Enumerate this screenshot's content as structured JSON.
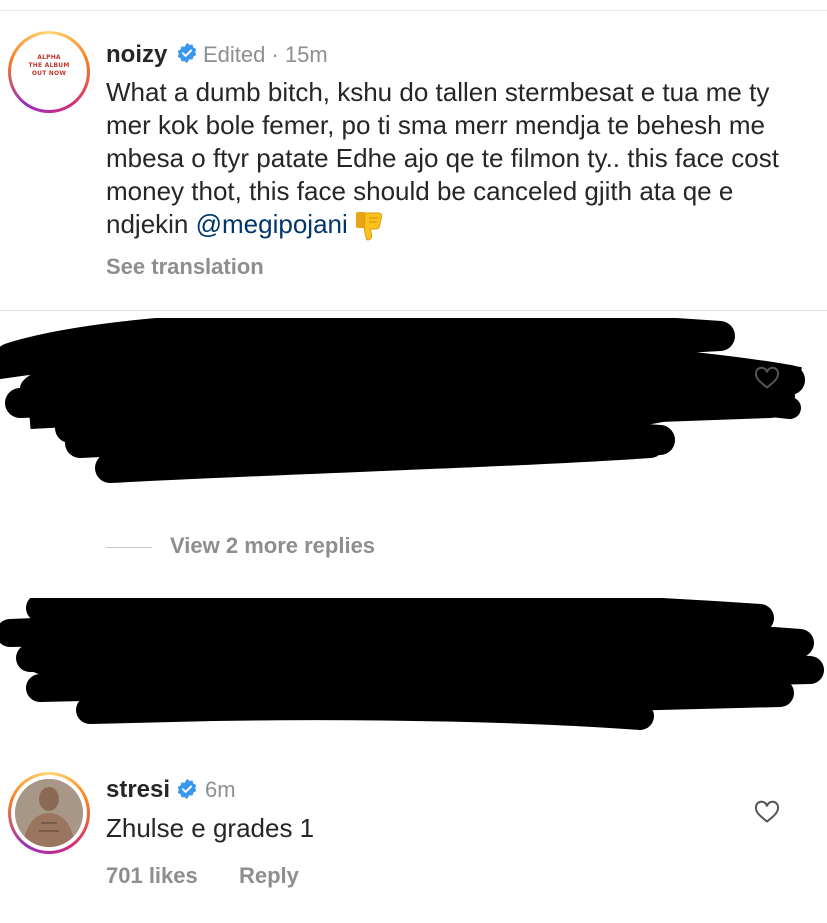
{
  "comments": [
    {
      "username": "noizy",
      "verified": true,
      "meta": "Edited · 15m",
      "avatar_text": [
        "ALPHA",
        "THE ALBUM",
        "OUT NOW"
      ],
      "text": "What a dumb bitch, kshu do tallen stermbesat e tua me ty mer kok bole femer, po ti sma merr mendja te behesh me mbesa o ftyr patate Edhe ajo qe te filmon ty.. this face cost money thot, this face should be canceled gjith ata qe e ndjekin ",
      "mention": "@megipojani",
      "emoji": "thumbs-down",
      "translation_link": "See translation"
    },
    {
      "username": "stresi",
      "verified": true,
      "meta": "6m",
      "text": "Zhulse e grades 1",
      "likes": "701 likes",
      "reply_label": "Reply"
    }
  ],
  "view_more_replies": "View 2 more replies",
  "colors": {
    "text": "#262626",
    "secondary": "#8e8e8e",
    "verified_blue": "#3897f0",
    "mention": "#00376b"
  }
}
